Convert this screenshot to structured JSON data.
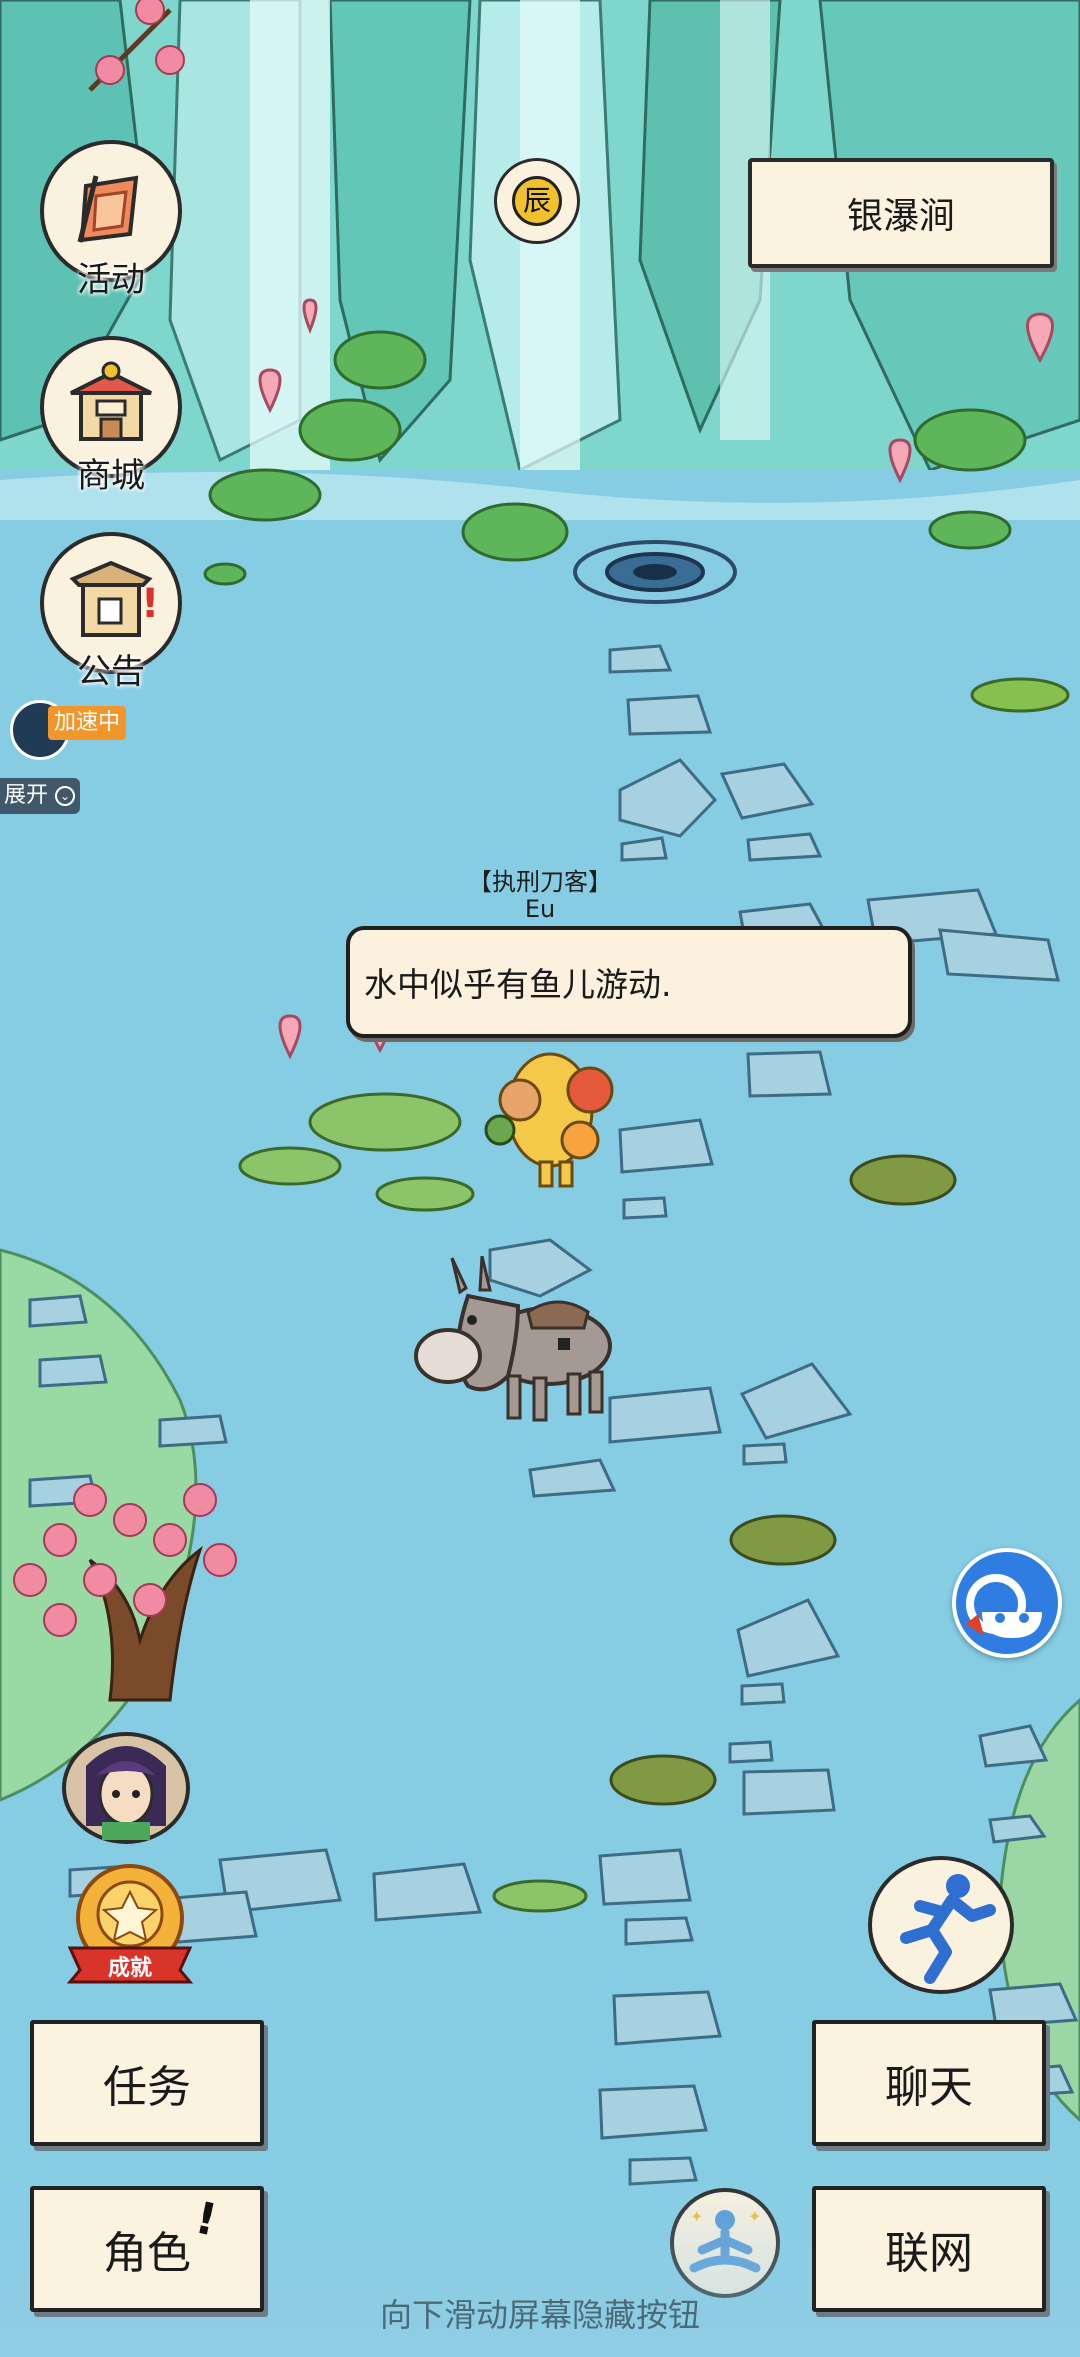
{
  "location": {
    "name": "银瀑涧"
  },
  "time_badge": {
    "label": "辰"
  },
  "side_menu": [
    {
      "id": "activity",
      "label": "活动",
      "icon": "flag-scroll-icon"
    },
    {
      "id": "shop",
      "label": "商城",
      "icon": "shop-stall-icon"
    },
    {
      "id": "notice",
      "label": "公告",
      "icon": "notice-board-icon"
    }
  ],
  "speed": {
    "badge": "加速中",
    "expand_label": "展开"
  },
  "player": {
    "title": "【执刑刀客】",
    "name": "Eu"
  },
  "dialog": {
    "text": "水中似乎有鱼儿游动."
  },
  "achievement_badge": {
    "label": "成就"
  },
  "buttons": {
    "task": "任务",
    "role": "角色",
    "chat": "聊天",
    "network": "联网"
  },
  "hint": "向下滑动屏幕隐藏按钮",
  "colors": {
    "water": "#84cce3",
    "panel": "#fcf2e0",
    "border": "#222222",
    "speed_badge": "#f0962a"
  }
}
